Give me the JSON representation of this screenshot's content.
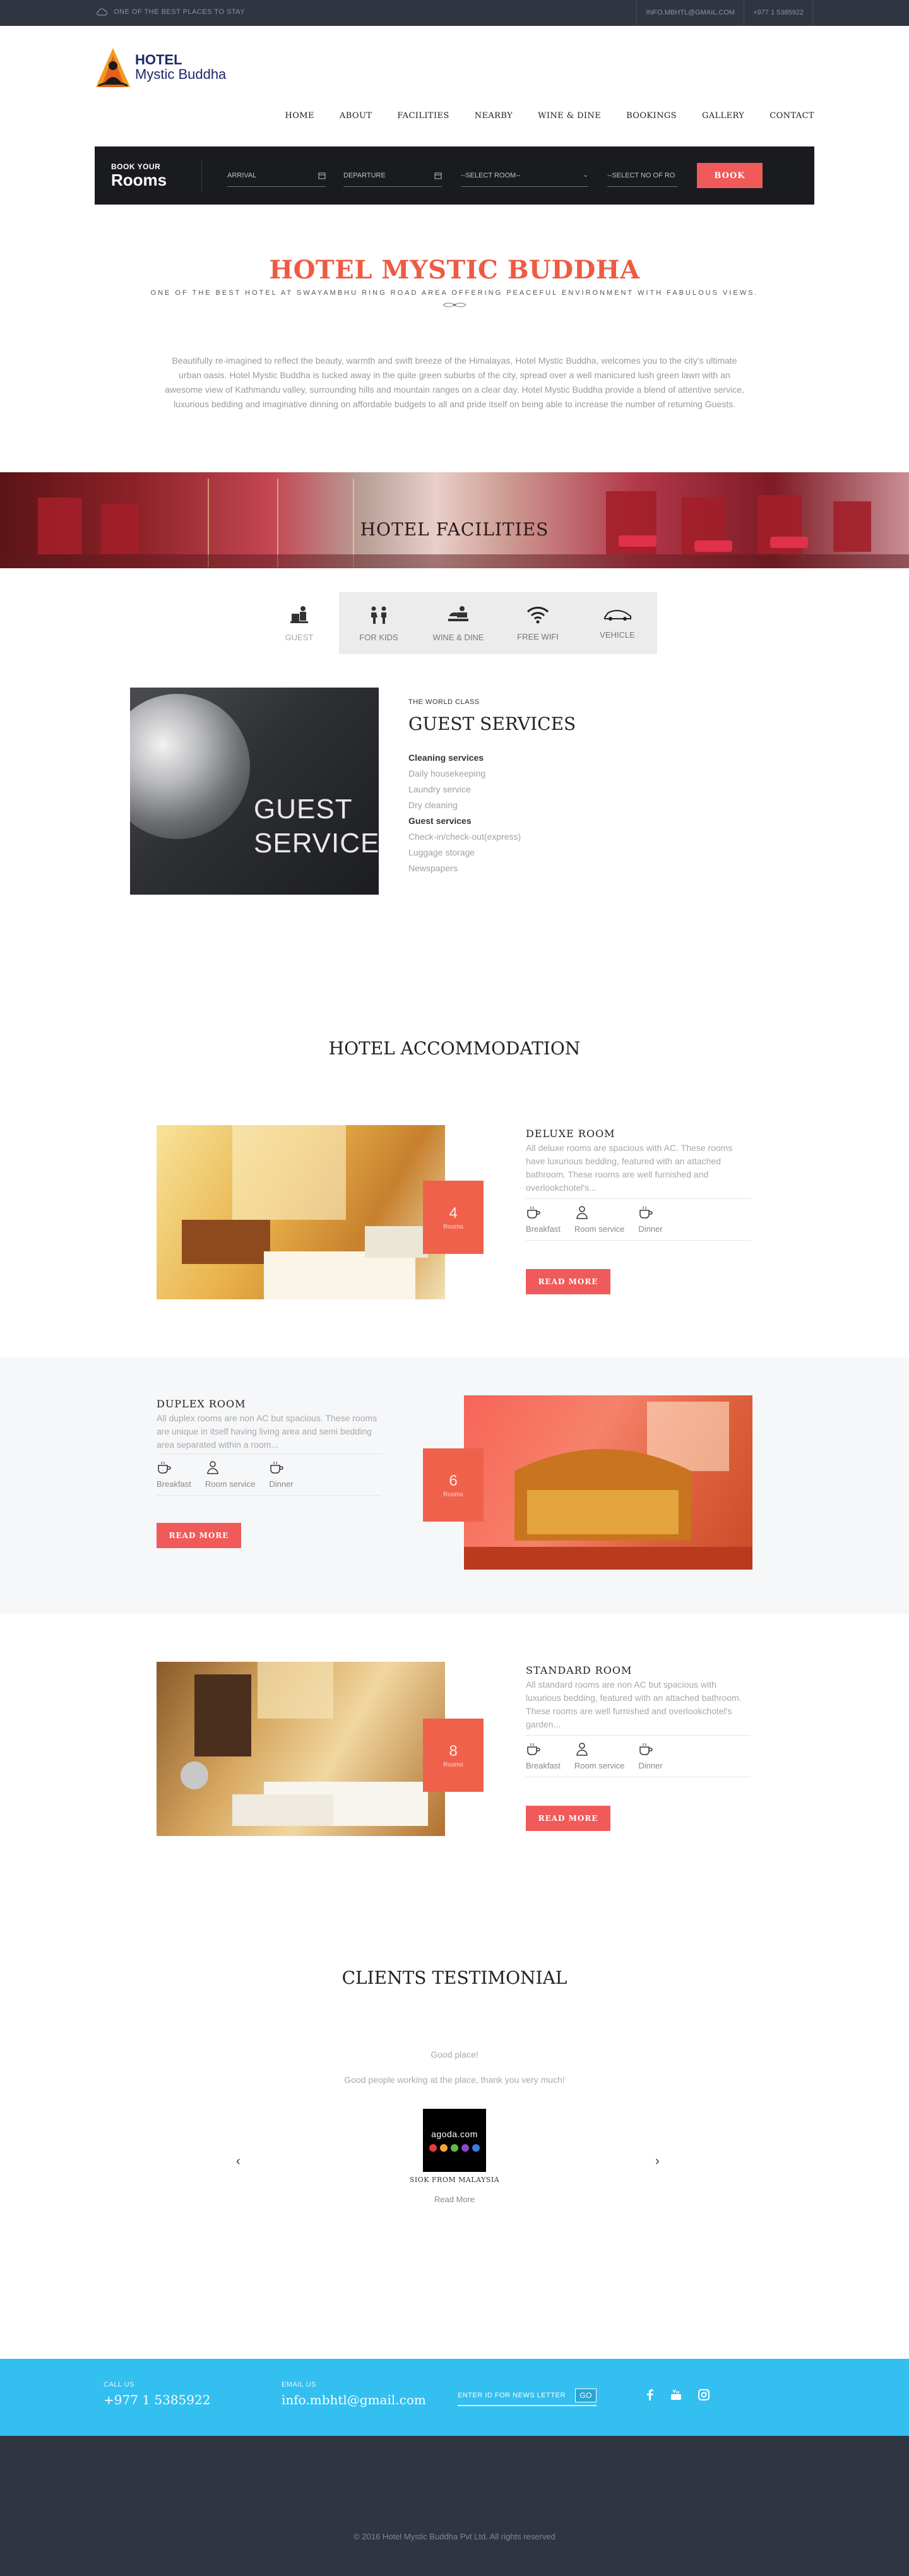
{
  "topbar": {
    "tagline": "ONE OF THE BEST PLACES TO STAY",
    "email": "INFO.MBHTL@GMAIL.COM",
    "phone": "+977 1 5385922"
  },
  "logo": {
    "line1": "HOTEL",
    "line2": "Mystic Buddha"
  },
  "nav": [
    "HOME",
    "ABOUT",
    "FACILITIES",
    "NEARBY",
    "WINE & DINE",
    "BOOKINGS",
    "GALLERY",
    "CONTACT"
  ],
  "booking": {
    "title_small": "BOOK YOUR",
    "title_big": "Rooms",
    "arrival": "ARRIVAL",
    "departure": "DEPARTURE",
    "room_select": "--SELECT ROOM--",
    "guests_select": "--SELECT NO OF RO",
    "book": "BOOK"
  },
  "intro": {
    "title": "HOTEL MYSTIC BUDDHA",
    "subtitle": "ONE OF THE BEST HOTEL AT SWAYAMBHU RING ROAD AREA OFFERING PEACEFUL ENVIRONMENT WITH FABULOUS VIEWS.",
    "paragraph": "Beautifully re-imagined to reflect the beauty, warmth and swift breeze of the Himalayas, Hotel Mystic Buddha, welcomes you to the city's ultimate urban oasis. Hotel Mystic Buddha is tucked away in the quite green suburbs of the city, spread over a well manicured lush green lawn with an awesome view of Kathmandu valley, surrounding hills and mountain ranges on a clear day. Hotel Mystic Buddha provide a blend of attentive service, luxurious bedding and imaginative dinning on affordable budgets to all and pride itself on being able to increase the number of returning Guests."
  },
  "facilities": {
    "title": "HOTEL FACILITIES",
    "tabs": [
      {
        "label": "GUEST",
        "icon": "bellboy-icon"
      },
      {
        "label": "FOR KIDS",
        "icon": "kids-icon"
      },
      {
        "label": "WINE & DINE",
        "icon": "dining-icon"
      },
      {
        "label": "FREE WIFI",
        "icon": "wifi-icon"
      },
      {
        "label": "VEHICLE",
        "icon": "car-icon"
      }
    ],
    "image_text_1": "GUEST",
    "image_text_2": "SERVICES",
    "kicker": "THE WORLD CLASS",
    "heading": "GUEST SERVICES",
    "list": [
      {
        "text": "Cleaning services",
        "header": true
      },
      {
        "text": "Daily housekeeping",
        "header": false
      },
      {
        "text": "Laundry service",
        "header": false
      },
      {
        "text": "Dry cleaning",
        "header": false
      },
      {
        "text": "Guest services",
        "header": true
      },
      {
        "text": "Check-in/check-out(express)",
        "header": false
      },
      {
        "text": "Luggage storage",
        "header": false
      },
      {
        "text": "Newspapers",
        "header": false
      }
    ]
  },
  "accommodation": {
    "title": "HOTEL ACCOMMODATION",
    "rooms": [
      {
        "name": "DELUXE ROOM",
        "count": "4",
        "count_label": "Rooms",
        "desc": "All deluxe rooms are spacious with AC. These rooms have luxurious bedding, featured with an attached bathroom. These rooms are well furnished and overlookchotel's...",
        "amenities": [
          "Breakfast",
          "Room service",
          "Dinner"
        ],
        "cta": "READ MORE"
      },
      {
        "name": "DUPLEX ROOM",
        "count": "6",
        "count_label": "Rooms",
        "desc": "All duplex rooms are non AC but spacious. These rooms are unique in itself having living area and semi bedding area separated within a room...",
        "amenities": [
          "Breakfast",
          "Room service",
          "Dinner"
        ],
        "cta": "READ MORE"
      },
      {
        "name": "STANDARD ROOM",
        "count": "8",
        "count_label": "Rooms",
        "desc": "All standard rooms are non AC but spacious with luxurious bedding, featured with an attached bathroom. These rooms are well furnished and overlookchotel's garden...",
        "amenities": [
          "Breakfast",
          "Room service",
          "Dinner"
        ],
        "cta": "READ MORE"
      }
    ]
  },
  "testimonial": {
    "title": "CLIENTS TESTIMONIAL",
    "headline": "Good place!",
    "quote": "Good people working at the place, thank you very much!",
    "logo_text": "agoda.com",
    "author": "SIOK FROM MALAYSIA",
    "read_more": "Read More",
    "prev": "‹",
    "next": "›"
  },
  "footer": {
    "call_label": "CALL US",
    "call_value": "+977 1 5385922",
    "email_label": "EMAIL US",
    "email_value": "info.mbhtl@gmail.com",
    "newsletter_placeholder": "ENTER ID FOR NEWS LETTER",
    "go": "GO",
    "social": [
      "facebook-icon",
      "youtube-icon",
      "instagram-icon"
    ],
    "copyright": "© 2016 Hotel Mystic Buddha Pvt Ltd. All rights reserved",
    "accent": "#33bff0"
  },
  "colors": {
    "brand": "#ef5a42",
    "button": "#f05a5a",
    "dark": "#2f3541"
  }
}
